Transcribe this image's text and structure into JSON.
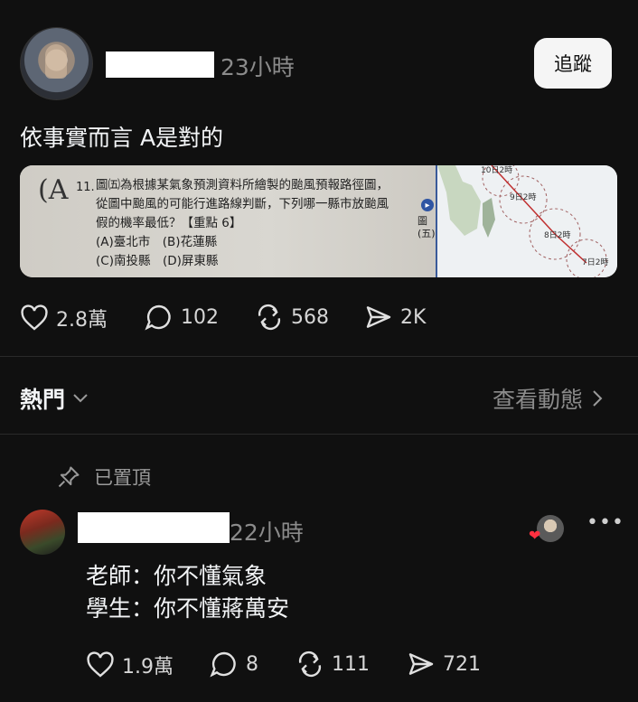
{
  "post": {
    "time": "23小時",
    "follow_label": "追蹤",
    "text": "依事實而言 A是對的",
    "image": {
      "lines": [
        "圖㈤為根據某氣象預測資料所繪製的颱風預報路徑圖，",
        "從圖中颱風的可能行進路線判斷，下列哪一縣市放颱風",
        "假的機率最低？【重點 6】",
        "(A)臺北市　(B)花蓮縣",
        "(C)南投縣　(D)屏東縣"
      ],
      "question_no": "11.",
      "answer_mark": "A",
      "figure_label": "圖(五)",
      "map_labels": [
        "10日2時",
        "9日2時",
        "8日2時",
        "7日2時"
      ]
    },
    "stats": {
      "likes": "2.8萬",
      "comments": "102",
      "reposts": "568",
      "shares": "2K"
    }
  },
  "filter": {
    "sort_label": "熱門",
    "activity_label": "查看動態"
  },
  "reply": {
    "pinned_label": "已置頂",
    "time": "22小時",
    "lines": [
      "老師：你不懂氣象",
      "學生：你不懂蔣萬安"
    ],
    "stats": {
      "likes": "1.9萬",
      "comments": "8",
      "reposts": "111",
      "shares": "721"
    }
  }
}
